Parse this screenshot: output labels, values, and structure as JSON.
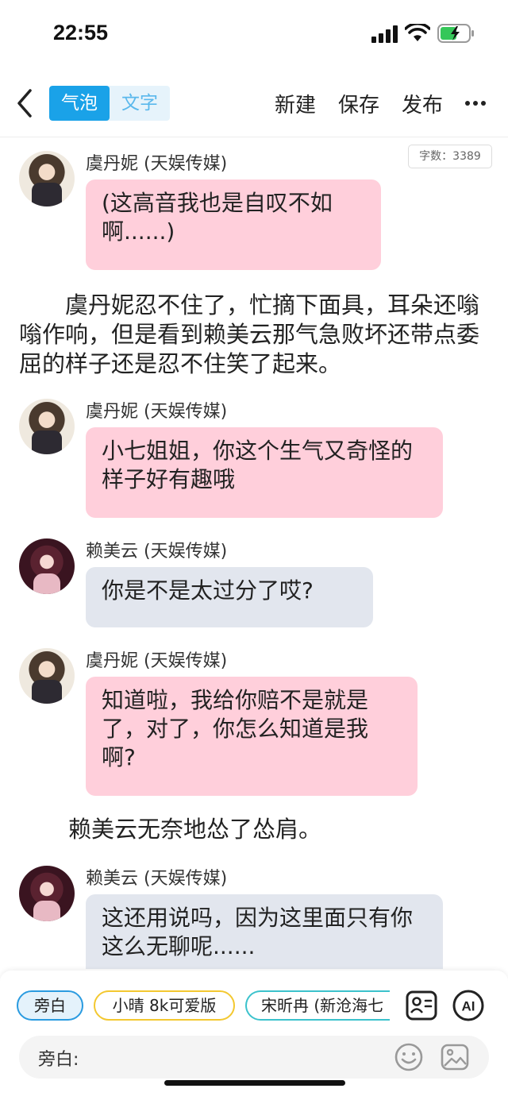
{
  "status_bar": {
    "time": "22:55"
  },
  "nav": {
    "mode_bubble": "气泡",
    "mode_text": "文字",
    "new": "新建",
    "save": "保存",
    "publish": "发布"
  },
  "word_count": "字数：3389",
  "chat": {
    "m1": {
      "speaker": "虞丹妮 (天娱传媒)",
      "text": "(这高音我也是自叹不如啊......)"
    },
    "n1": "　　虞丹妮忍不住了，忙摘下面具，耳朵还嗡嗡作响，但是看到赖美云那气急败坏还带点委屈的样子还是忍不住笑了起来。",
    "m2": {
      "speaker": "虞丹妮 (天娱传媒)",
      "text": "小七姐姐，你这个生气又奇怪的样子好有趣哦"
    },
    "m3": {
      "speaker": "赖美云 (天娱传媒)",
      "text": "你是不是太过分了哎?"
    },
    "m4": {
      "speaker": "虞丹妮 (天娱传媒)",
      "text": "知道啦，我给你赔不是就是了，对了，你怎么知道是我啊?"
    },
    "n2": "赖美云无奈地怂了怂肩。",
    "m5": {
      "speaker": "赖美云 (天娱传媒)",
      "text": "这还用说吗，因为这里面只有你这么无聊呢......"
    }
  },
  "bottom": {
    "chips": [
      "旁白",
      "小晴 8k可爱版",
      "宋昕冉 (新沧海七"
    ],
    "ai_label": "AI",
    "input_label": "旁白:"
  },
  "colors": {
    "accent": "#1aa2e8",
    "bubble_pink": "#ffcfdb",
    "bubble_gray": "#e2e6ee"
  }
}
